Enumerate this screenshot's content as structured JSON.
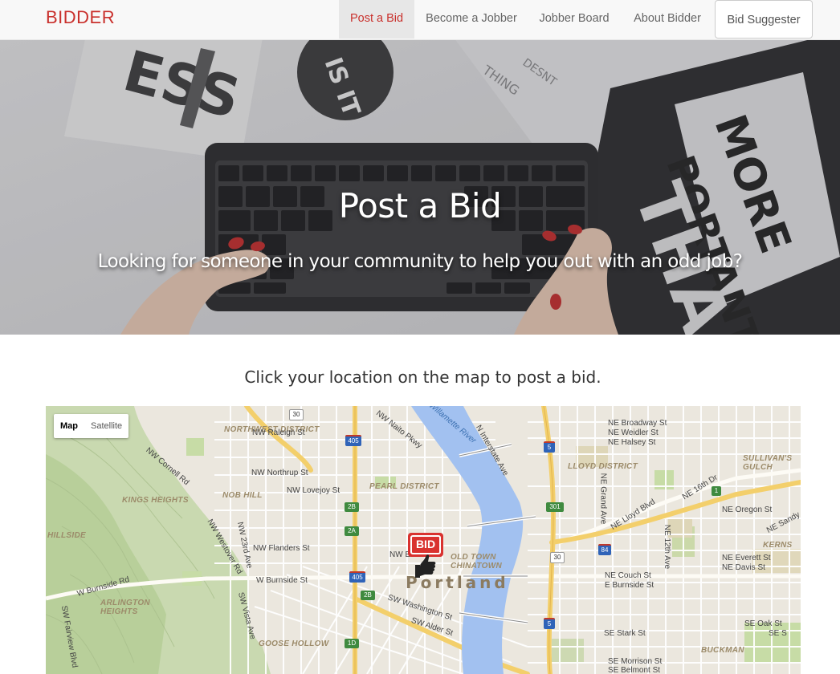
{
  "nav": {
    "brand": "BIDDER",
    "items": [
      {
        "label": "Post a Bid",
        "active": true
      },
      {
        "label": "Become a Jobber",
        "active": false
      },
      {
        "label": "Jobber Board",
        "active": false
      },
      {
        "label": "About Bidder",
        "active": false
      }
    ],
    "cta": "Bid Suggester"
  },
  "hero": {
    "title": "Post a Bid",
    "subtitle": "Looking for someone in your community to help you out with an odd job?"
  },
  "main": {
    "prompt": "Click your location on the map to post a bid."
  },
  "map": {
    "type_controls": [
      "Map",
      "Satellite"
    ],
    "selected_type": "Map",
    "city": "Portland",
    "districts": [
      "NORTHWEST DISTRICT",
      "PEARL DISTRICT",
      "NOB HILL",
      "KINGS HEIGHTS",
      "HILLSIDE",
      "ARLINGTON HEIGHTS",
      "GOOSE HOLLOW",
      "OLD TOWN CHINATOWN",
      "LLOYD DISTRICT",
      "SULLIVAN'S GULCH",
      "KERNS",
      "BUCKMAN"
    ],
    "streets": [
      "NW Raleigh St",
      "NW Northrup St",
      "NW Lovejoy St",
      "NW Flanders St",
      "W Burnside St",
      "NW Everett St",
      "SW Washington St",
      "SW Alder St",
      "NW Naito Pkwy",
      "NW 23rd Ave",
      "NW Westover Rd",
      "NW Cornell Rd",
      "SW Vista Ave",
      "NE Broadway St",
      "NE Weidler St",
      "NE Halsey St",
      "NE Oregon St",
      "NE Everett St",
      "NE Davis St",
      "NE Couch St",
      "E Burnside St",
      "SE Stark St",
      "SE Oak St",
      "SE Morrison St",
      "SE Belmont St",
      "NE Grand Ave",
      "NE 12th Ave",
      "NE Lloyd Blvd",
      "NE 16th Dr",
      "N Interstate Ave",
      "NE Sandy",
      "W Burnside Rd",
      "SW Fairview Blvd",
      "NW Davis St",
      "SE S"
    ],
    "water": "Willamette River",
    "marker_label": "BID",
    "highway_shields": [
      "30",
      "405",
      "5",
      "2B",
      "2A",
      "301",
      "1",
      "84",
      "1D"
    ]
  },
  "colors": {
    "brand": "#c9302c",
    "nav_bg": "#f8f8f8",
    "river": "#a2c1f0",
    "highway": "#f3cf6b"
  }
}
